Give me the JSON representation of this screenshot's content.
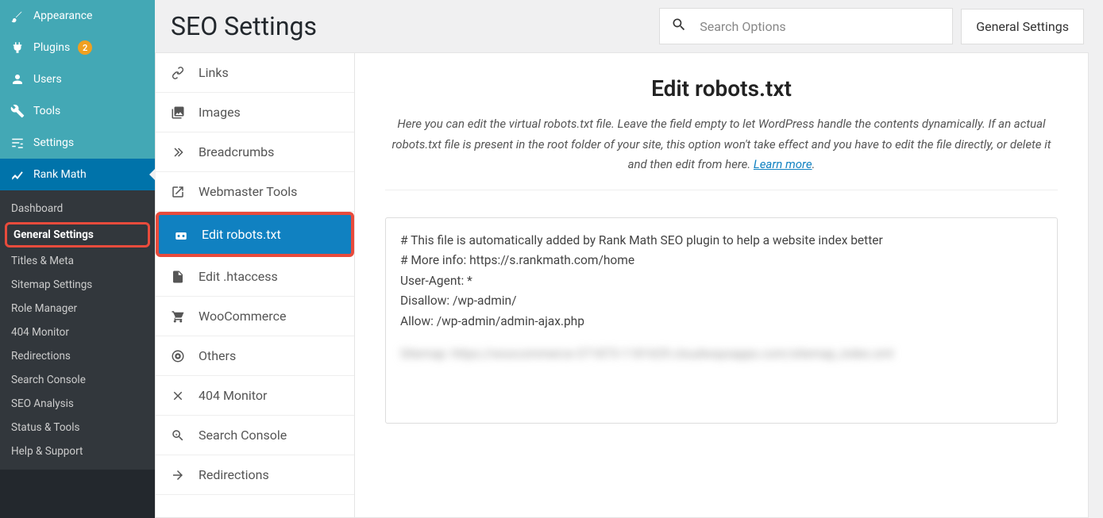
{
  "wp_sidebar": {
    "top": [
      {
        "icon": "brush",
        "label": "Appearance"
      },
      {
        "icon": "plug",
        "label": "Plugins",
        "badge": "2"
      },
      {
        "icon": "user",
        "label": "Users"
      },
      {
        "icon": "wrench",
        "label": "Tools"
      },
      {
        "icon": "slider",
        "label": "Settings"
      }
    ],
    "active": {
      "icon": "chart",
      "label": "Rank Math"
    },
    "sub": [
      {
        "label": "Dashboard"
      },
      {
        "label": "General Settings",
        "current": true
      },
      {
        "label": "Titles & Meta"
      },
      {
        "label": "Sitemap Settings"
      },
      {
        "label": "Role Manager"
      },
      {
        "label": "404 Monitor"
      },
      {
        "label": "Redirections"
      },
      {
        "label": "Search Console"
      },
      {
        "label": "SEO Analysis"
      },
      {
        "label": "Status & Tools"
      },
      {
        "label": "Help & Support"
      }
    ]
  },
  "header": {
    "title": "SEO Settings",
    "search_placeholder": "Search Options",
    "button": "General Settings"
  },
  "tabs": [
    {
      "icon": "link",
      "label": "Links"
    },
    {
      "icon": "images",
      "label": "Images"
    },
    {
      "icon": "chev",
      "label": "Breadcrumbs"
    },
    {
      "icon": "ext",
      "label": "Webmaster Tools"
    },
    {
      "icon": "robot",
      "label": "Edit robots.txt",
      "active": true
    },
    {
      "icon": "file",
      "label": "Edit .htaccess"
    },
    {
      "icon": "cart",
      "label": "WooCommerce"
    },
    {
      "icon": "target",
      "label": "Others"
    },
    {
      "icon": "x",
      "label": "404 Monitor"
    },
    {
      "icon": "zoom",
      "label": "Search Console"
    },
    {
      "icon": "redir",
      "label": "Redirections"
    }
  ],
  "panel": {
    "title": "Edit robots.txt",
    "desc_a": "Here you can edit the virtual robots.txt file. Leave the field empty to let WordPress handle the contents dynamically. If an actual robots.txt file is present in the root folder of your site, this option won't take effect and you have to edit the file directly, or delete it and then edit from here. ",
    "learn_more": "Learn more",
    "period": ".",
    "textarea": "# This file is automatically added by Rank Math SEO plugin to help a website index better\n# More info: https://s.rankmath.com/home\nUser-Agent: *\nDisallow: /wp-admin/\nAllow: /wp-admin/admin-ajax.php",
    "blurred": "Sitemap: https://woocommerce-371873-1181629.cloudwaysapps.com/sitemap_index.xml"
  }
}
